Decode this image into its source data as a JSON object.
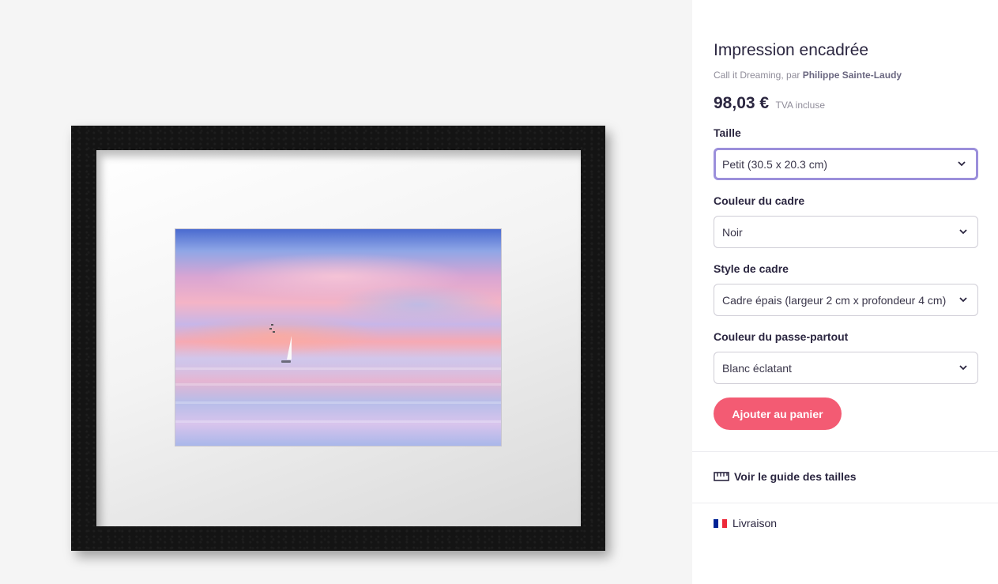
{
  "product": {
    "title": "Impression encadrée",
    "subtitle_prefix": "Call it Dreaming, par",
    "author": "Philippe Sainte-Laudy",
    "price": "98,03 €",
    "tax_note": "TVA incluse"
  },
  "options": [
    {
      "label": "Taille",
      "value": "Petit (30.5 x 20.3 cm)"
    },
    {
      "label": "Couleur du cadre",
      "value": "Noir"
    },
    {
      "label": "Style de cadre",
      "value": "Cadre épais (largeur 2 cm x profondeur 4 cm)"
    },
    {
      "label": "Couleur du passe-partout",
      "value": "Blanc éclatant"
    }
  ],
  "actions": {
    "add_to_cart": "Ajouter au panier",
    "size_guide": "Voir le guide des tailles",
    "shipping": "Livraison"
  },
  "colors": {
    "accent_button": "#f35b73",
    "focus_border": "#9b8fdb",
    "frame": "#141414",
    "flag_blue": "#002395",
    "flag_white": "#ffffff",
    "flag_red": "#ed2939"
  },
  "icons": {
    "chevron": "chevron-down-icon",
    "ruler": "ruler-icon",
    "flag": "france-flag-icon"
  }
}
